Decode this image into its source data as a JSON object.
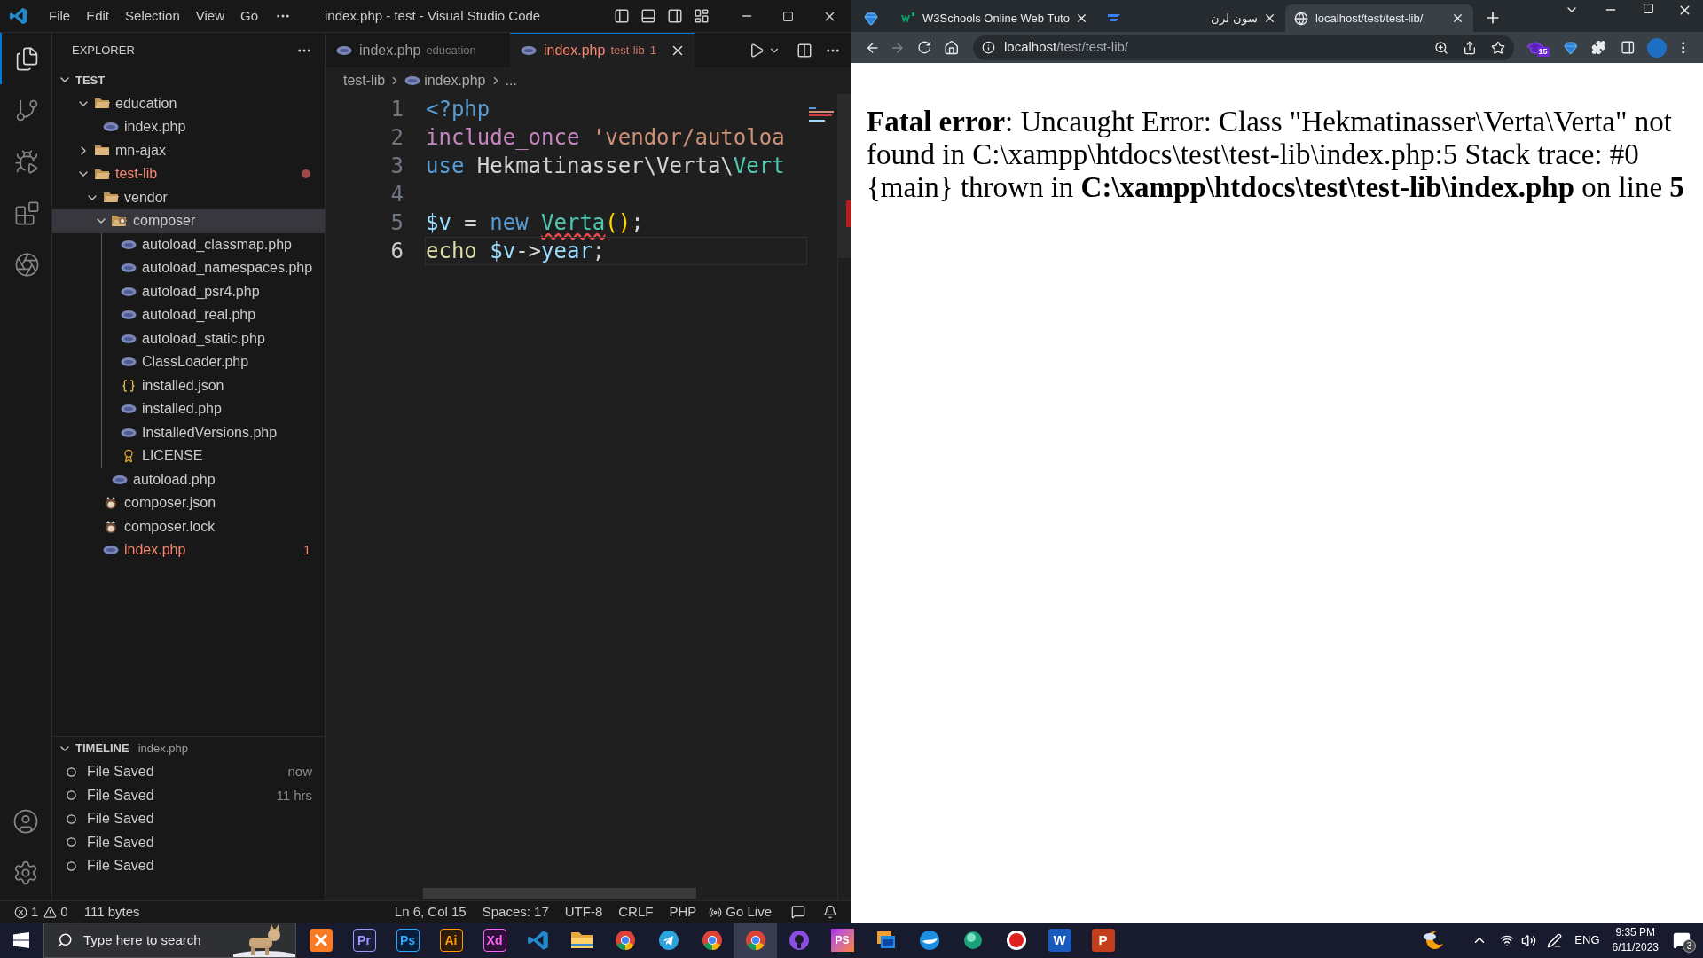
{
  "vscode": {
    "menu": [
      "File",
      "Edit",
      "Selection",
      "View",
      "Go"
    ],
    "title": "index.php - test - Visual Studio Code",
    "activity_bar": [
      {
        "kind": "files",
        "selected": true
      },
      {
        "kind": "source-control",
        "selected": false
      },
      {
        "kind": "run-debug",
        "selected": false
      },
      {
        "kind": "extensions",
        "selected": false
      },
      {
        "kind": "aperture",
        "selected": false
      }
    ],
    "sidebar": {
      "title": "EXPLORER",
      "root": "TEST",
      "tree": [
        {
          "name": "education",
          "kind": "folder",
          "expanded": true,
          "selected": false,
          "error": false,
          "children": [
            {
              "name": "index.php",
              "kind": "php",
              "selected": false,
              "error": false
            }
          ]
        },
        {
          "name": "mn-ajax",
          "kind": "folder",
          "expanded": false,
          "selected": false,
          "error": false
        },
        {
          "name": "test-lib",
          "kind": "folder",
          "expanded": true,
          "selected": false,
          "error": true,
          "children": [
            {
              "name": "vendor",
              "kind": "folder",
              "expanded": true,
              "selected": false,
              "error": false,
              "children": [
                {
                  "name": "composer",
                  "kind": "composer-folder",
                  "expanded": true,
                  "selected": true,
                  "error": false,
                  "children": [
                    {
                      "name": "autoload_classmap.php",
                      "kind": "php",
                      "selected": false,
                      "error": false
                    },
                    {
                      "name": "autoload_namespaces.php",
                      "kind": "php",
                      "selected": false,
                      "error": false
                    },
                    {
                      "name": "autoload_psr4.php",
                      "kind": "php",
                      "selected": false,
                      "error": false
                    },
                    {
                      "name": "autoload_real.php",
                      "kind": "php",
                      "selected": false,
                      "error": false
                    },
                    {
                      "name": "autoload_static.php",
                      "kind": "php",
                      "selected": false,
                      "error": false
                    },
                    {
                      "name": "ClassLoader.php",
                      "kind": "php",
                      "selected": false,
                      "error": false
                    },
                    {
                      "name": "installed.json",
                      "kind": "json",
                      "selected": false,
                      "error": false
                    },
                    {
                      "name": "installed.php",
                      "kind": "php",
                      "selected": false,
                      "error": false
                    },
                    {
                      "name": "InstalledVersions.php",
                      "kind": "php",
                      "selected": false,
                      "error": false
                    },
                    {
                      "name": "LICENSE",
                      "kind": "license",
                      "selected": false,
                      "error": false
                    }
                  ]
                },
                {
                  "name": "autoload.php",
                  "kind": "php",
                  "selected": false,
                  "error": false
                }
              ]
            },
            {
              "name": "composer.json",
              "kind": "composer",
              "selected": false,
              "error": false
            },
            {
              "name": "composer.lock",
              "kind": "composer",
              "selected": false,
              "error": false
            },
            {
              "name": "index.php",
              "kind": "php",
              "selected": false,
              "error": true,
              "badge": "1"
            }
          ]
        }
      ]
    },
    "timeline": {
      "title": "TIMELINE",
      "file": "index.php",
      "entries": [
        {
          "label": "File Saved",
          "time": "now"
        },
        {
          "label": "File Saved",
          "time": "11 hrs"
        },
        {
          "label": "File Saved"
        },
        {
          "label": "File Saved"
        },
        {
          "label": "File Saved"
        }
      ]
    },
    "tabs": [
      {
        "label": "index.php",
        "description": "education",
        "selected": false
      },
      {
        "label": "index.php",
        "description": "test-lib",
        "problems": "1",
        "selected": true
      }
    ],
    "breadcrumb": [
      "test-lib",
      "index.php",
      "..."
    ],
    "code": [
      {
        "number": "1",
        "current": false,
        "tokens": [
          {
            "text": "<?php",
            "kind": "keyword"
          }
        ]
      },
      {
        "number": "2",
        "current": false,
        "tokens": [
          {
            "text": "include_once ",
            "kind": "control"
          },
          {
            "text": "'vendor/autoloa",
            "kind": "string"
          }
        ]
      },
      {
        "number": "3",
        "current": false,
        "tokens": [
          {
            "text": "use",
            "kind": "keyword"
          },
          {
            "text": " Hekmatinasser\\Verta\\",
            "kind": "plain"
          },
          {
            "text": "Vert",
            "kind": "class"
          }
        ]
      },
      {
        "number": "4",
        "current": false
      },
      {
        "number": "5",
        "current": false,
        "tokens": [
          {
            "text": "$v",
            "kind": "variable"
          },
          {
            "text": " = ",
            "kind": "plain"
          },
          {
            "text": "new ",
            "kind": "keyword"
          },
          {
            "text": "Verta",
            "kind": "class-unknown"
          },
          {
            "text": "()",
            "kind": "bracket"
          },
          {
            "text": ";",
            "kind": "plain"
          }
        ]
      },
      {
        "number": "6",
        "current": true,
        "tokens": [
          {
            "text": "echo ",
            "kind": "function"
          },
          {
            "text": "$v",
            "kind": "variable"
          },
          {
            "text": "->",
            "kind": "plain"
          },
          {
            "text": "year",
            "kind": "variable"
          },
          {
            "text": ";",
            "kind": "plain"
          }
        ]
      }
    ],
    "status_bar": {
      "errors": "1",
      "warnings": "0",
      "size": "111 bytes",
      "position": "Ln 6, Col 15",
      "indent": "Spaces: 17",
      "encoding": "UTF-8",
      "eol": "CRLF",
      "language": "PHP",
      "live": "Go Live"
    }
  },
  "browser": {
    "tabs": [
      {
        "kind": "gem",
        "selected": false
      },
      {
        "kind": "site",
        "title": "W3Schools Online Web Tuto",
        "selected": false
      },
      {
        "kind": "lines",
        "title": "سون لرن",
        "selected": false
      },
      {
        "kind": "globe",
        "title": "localhost/test/test-lib/",
        "selected": true
      }
    ],
    "forward_enabled": false,
    "address": {
      "host": "localhost",
      "path": "/test/test-lib/"
    },
    "extension_badge": "15",
    "page_text": "**Fatal error**: Uncaught Error: Class \"Hekmatinasser\\Verta\\Verta\" not found in C:\\xampp\\htdocs\\test\\test-lib\\index.php:5 Stack trace: #0 {main} thrown in **C:\\xampp\\htdocs\\test\\test-lib\\index.php** on line **5**"
  },
  "taskbar": {
    "search_placeholder": "Type here to search",
    "apps": [
      {
        "kind": "xampp",
        "selected": false
      },
      {
        "kind": "adobe",
        "label": "Pr",
        "color": "#9999ff",
        "selected": false
      },
      {
        "kind": "adobe",
        "label": "Ps",
        "color": "#31a8ff",
        "selected": false
      },
      {
        "kind": "adobe",
        "label": "Ai",
        "color": "#ff9a00",
        "selected": false
      },
      {
        "kind": "adobe",
        "label": "Xd",
        "color": "#ff61f6",
        "selected": false
      },
      {
        "kind": "code",
        "selected": false
      },
      {
        "kind": "folder",
        "selected": false
      },
      {
        "kind": "chrome",
        "selected": false
      },
      {
        "kind": "telegram",
        "selected": false
      },
      {
        "kind": "chrome",
        "selected": false
      },
      {
        "kind": "chrome",
        "selected": true
      },
      {
        "kind": "github",
        "selected": false
      },
      {
        "kind": "jetbrains",
        "label": "PS",
        "selected": false
      },
      {
        "kind": "window",
        "selected": false
      },
      {
        "kind": "whale",
        "selected": false
      },
      {
        "kind": "sphere",
        "selected": false
      },
      {
        "kind": "record",
        "selected": false
      },
      {
        "kind": "office",
        "label": "W",
        "color": "#185abd",
        "selected": false
      },
      {
        "kind": "office",
        "label": "P",
        "color": "#c43e1c",
        "selected": false
      }
    ],
    "language": "ENG",
    "time": "9:35 PM",
    "date": "6/11/2023",
    "notifications": "3"
  }
}
